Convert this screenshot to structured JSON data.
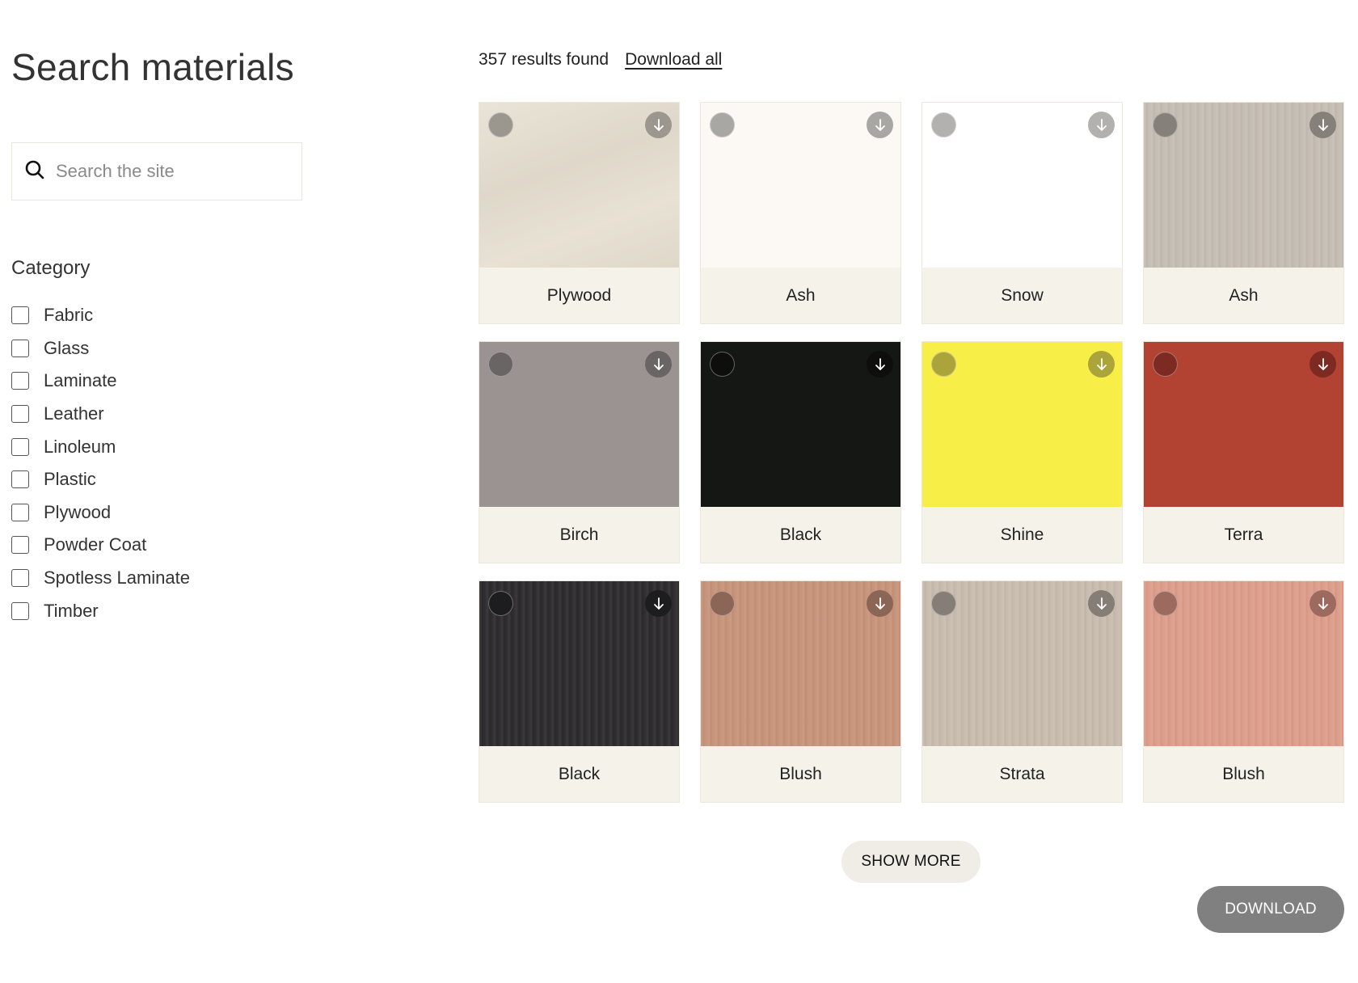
{
  "sidebar": {
    "title": "Search materials",
    "search": {
      "placeholder": "Search the site",
      "value": "",
      "icon": "search-icon"
    },
    "category": {
      "title": "Category",
      "items": [
        {
          "label": "Fabric",
          "checked": false
        },
        {
          "label": "Glass",
          "checked": false
        },
        {
          "label": "Laminate",
          "checked": false
        },
        {
          "label": "Leather",
          "checked": false
        },
        {
          "label": "Linoleum",
          "checked": false
        },
        {
          "label": "Plastic",
          "checked": false
        },
        {
          "label": "Plywood",
          "checked": false
        },
        {
          "label": "Powder Coat",
          "checked": false
        },
        {
          "label": "Spotless Laminate",
          "checked": false
        },
        {
          "label": "Timber",
          "checked": false
        }
      ]
    }
  },
  "results": {
    "count_text": "357 results found",
    "download_all_label": "Download all",
    "materials": [
      {
        "name": "Plywood",
        "swatch": "#e6dfd0",
        "accent": "#9c978e",
        "texture": "ply"
      },
      {
        "name": "Ash",
        "swatch": "#fcf9f4",
        "accent": "#a8a7a4",
        "texture": "none"
      },
      {
        "name": "Snow",
        "swatch": "#ffffff",
        "accent": "#b2b1b0",
        "texture": "none"
      },
      {
        "name": "Ash",
        "swatch": "#c5bdb3",
        "accent": "#858079",
        "texture": "wood"
      },
      {
        "name": "Birch",
        "swatch": "#9a9392",
        "accent": "#6a6565",
        "texture": "none"
      },
      {
        "name": "Black",
        "swatch": "#151714",
        "accent": "#0e0f0d",
        "texture": "none"
      },
      {
        "name": "Shine",
        "swatch": "#f7ee47",
        "accent": "#aaa43a",
        "texture": "none"
      },
      {
        "name": "Terra",
        "swatch": "#b24232",
        "accent": "#7d2a22",
        "texture": "none"
      },
      {
        "name": "Black",
        "swatch": "#2d2b2e",
        "accent": "#1d1c1e",
        "texture": "wood"
      },
      {
        "name": "Blush",
        "swatch": "#c7937a",
        "accent": "#8b6555",
        "texture": "wood"
      },
      {
        "name": "Strata",
        "swatch": "#c8bcae",
        "accent": "#857e76",
        "texture": "wood"
      },
      {
        "name": "Blush",
        "swatch": "#dd9d8b",
        "accent": "#9d6a5f",
        "texture": "wood"
      }
    ]
  },
  "actions": {
    "show_more_label": "SHOW MORE",
    "download_label": "DOWNLOAD"
  }
}
